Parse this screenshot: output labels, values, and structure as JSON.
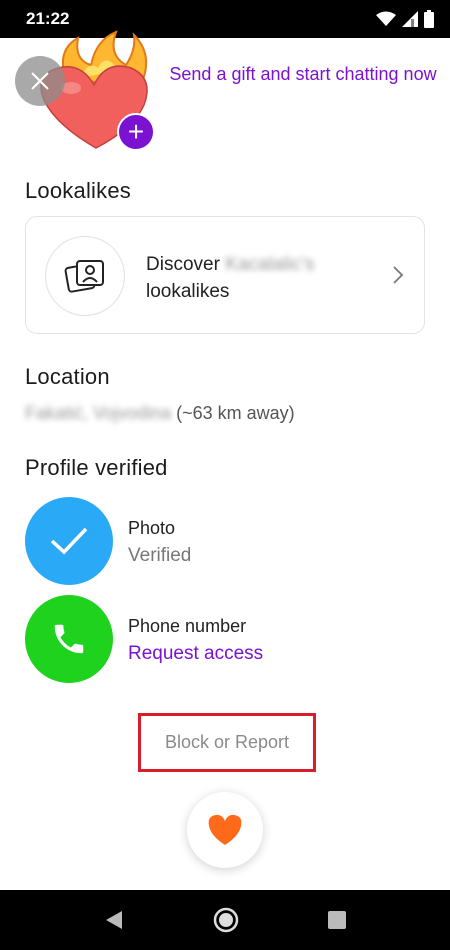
{
  "status_bar": {
    "time": "21:22"
  },
  "gift": {
    "text": "Send a gift and start chatting now",
    "plus": "+"
  },
  "lookalikes": {
    "title": "Lookalikes",
    "discover": "Discover",
    "blurred_name": "Kacalalic's",
    "suffix": "lookalikes"
  },
  "location": {
    "title": "Location",
    "blurred_place": "Fakatić, Vojvodina",
    "distance": "(~63 km away)"
  },
  "verified": {
    "title": "Profile verified",
    "photo": {
      "label": "Photo",
      "status": "Verified"
    },
    "phone": {
      "label": "Phone number",
      "action": "Request access"
    }
  },
  "block_report": "Block or Report",
  "colors": {
    "accent": "#7b12d2",
    "photo_verified": "#2aa9f7",
    "phone_verified": "#1ed21e",
    "like": "#ff6a1a",
    "highlight_box": "#d81e2a"
  }
}
